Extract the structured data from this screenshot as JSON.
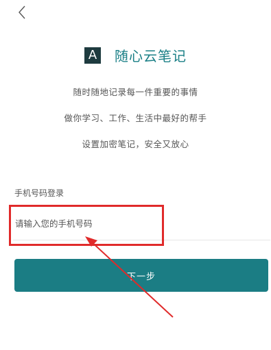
{
  "nav": {
    "back_icon": "chevron-left-icon"
  },
  "logo": {
    "letter": "A",
    "app_name": "随心云笔记",
    "brand_color": "#1a7f86",
    "logo_bg_color": "#1e3b3f"
  },
  "slogans": [
    "随时随地记录每一件重要的事情",
    "做你学习、工作、生活中最好的帮手",
    "设置加密笔记，安全又放心"
  ],
  "login": {
    "label": "手机号码登录",
    "phone_placeholder": "请输入您的手机号码",
    "phone_value": "",
    "next_button_label": "下一步",
    "button_color": "#1b7d84"
  },
  "annotation": {
    "color": "#e02a2a"
  }
}
